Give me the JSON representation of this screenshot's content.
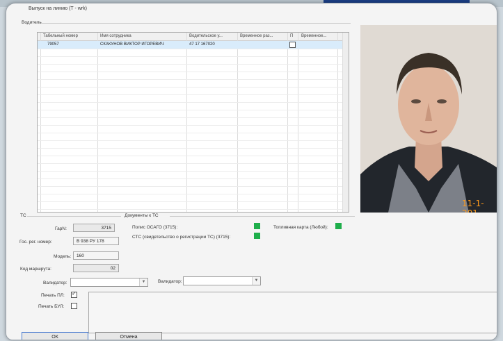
{
  "window": {
    "title": "Выпуск на линию (T - wrk)"
  },
  "driver_group": {
    "title": "Водитель"
  },
  "grid": {
    "columns": [
      "Табельный номер",
      "Имя сотрудника",
      "Водительское у...",
      "Временное раз...",
      "П",
      "Временное..."
    ],
    "rows": [
      {
        "tab_number": "79057",
        "employee_name": "СКАКУНОВ ВИКТОР ИГОРЕВИЧ",
        "license": "47 17 167020",
        "temp_permit": "",
        "p_checked": false,
        "temp2": ""
      }
    ]
  },
  "photo": {
    "timestamp": "11-1-201"
  },
  "ts_group": {
    "title": "ТС",
    "garage_label": "ГарN:",
    "garage_value": "3715",
    "reg_label": "Гос. рег. номер:",
    "reg_value": "В 938 РУ 178",
    "model_label": "Модель:",
    "model_value": "160",
    "route_label": "Код маршрута:",
    "route_value": "02"
  },
  "docs_group": {
    "title": "Документы к ТС",
    "osago_label": "Полис ОСАГО (3715):",
    "sts_label": "СТС (свидетельство о регистрации ТС) (3715):",
    "fuel_label": "Топливная карта (Любой):",
    "status_color": "#1fae4b"
  },
  "validators": {
    "label1": "Валидатор:",
    "value1": "",
    "label2": "Валидатор:",
    "value2": ""
  },
  "print": {
    "pl_label": "Печать ПЛ:",
    "pl_checked": true,
    "bul_label": "Печать БУЛ:",
    "bul_checked": false
  },
  "buttons": {
    "ok": "ОК",
    "cancel": "Отмена"
  }
}
